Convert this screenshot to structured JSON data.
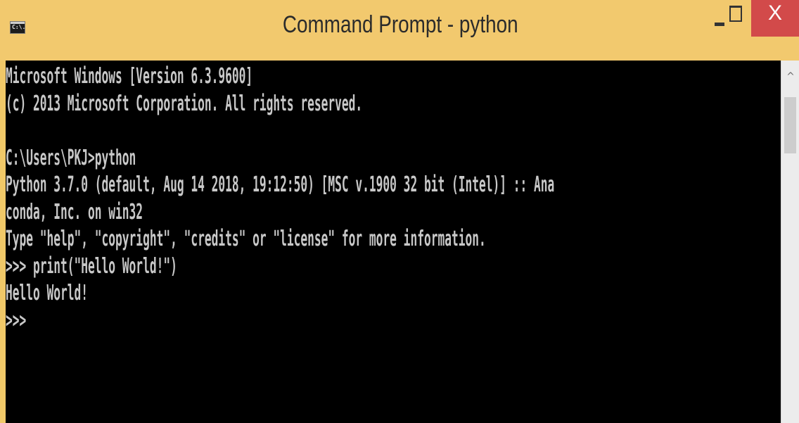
{
  "window": {
    "title": "Command Prompt - python",
    "icon_label": "C:\\.",
    "icon": "cmd-icon"
  },
  "controls": {
    "minimize_icon": "minimize-icon",
    "maximize_icon": "maximize-icon",
    "close_label": "X"
  },
  "console": {
    "lines": [
      "Microsoft Windows [Version 6.3.9600]",
      "(c) 2013 Microsoft Corporation. All rights reserved.",
      "",
      "C:\\Users\\PKJ>python",
      "Python 3.7.0 (default, Aug 14 2018, 19:12:50) [MSC v.1900 32 bit (Intel)] :: Ana",
      "conda, Inc. on win32",
      "Type \"help\", \"copyright\", \"credits\" or \"license\" for more information.",
      ">>> print(\"Hello World!\")",
      "Hello World!",
      ">>>"
    ]
  },
  "scrollbar": {
    "up_arrow": "^"
  },
  "colors": {
    "titlebar": "#f2c96e",
    "close_button": "#d24a4a",
    "console_background": "#000000",
    "console_text": "#c8c8c8"
  }
}
